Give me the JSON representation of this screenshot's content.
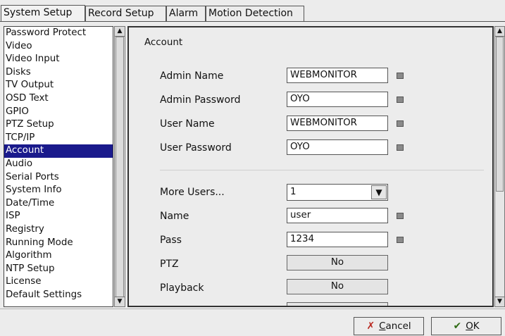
{
  "tabs": [
    "System Setup",
    "Record Setup",
    "Alarm",
    "Motion Detection"
  ],
  "sidebar": {
    "items": [
      "Password Protect",
      "Video",
      "Video Input",
      "Disks",
      "TV Output",
      "OSD Text",
      "GPIO",
      "PTZ Setup",
      "TCP/IP",
      "Account",
      "Audio",
      "Serial Ports",
      "System Info",
      "Date/Time",
      "ISP",
      "Registry",
      "Running Mode",
      "Algorithm",
      "NTP Setup",
      "License",
      "Default Settings"
    ],
    "selected": "Account"
  },
  "account": {
    "section_title": "Account",
    "admin_name_label": "Admin Name",
    "admin_name_value": "WEBMONITOR",
    "admin_password_label": "Admin Password",
    "admin_password_value": "OYO",
    "user_name_label": "User Name",
    "user_name_value": "WEBMONITOR",
    "user_password_label": "User Password",
    "user_password_value": "OYO",
    "more_users_label": "More Users...",
    "more_users_value": "1",
    "name_label": "Name",
    "name_value": "user",
    "pass_label": "Pass",
    "pass_value": "1234",
    "ptz_label": "PTZ",
    "ptz_value": "No",
    "playback_label": "Playback",
    "playback_value": "No"
  },
  "buttons": {
    "cancel_mnemonic": "C",
    "cancel_rest": "ancel",
    "ok_mnemonic": "O",
    "ok_rest": "K"
  },
  "colors": {
    "selection": "#1a1a8c"
  },
  "icons": [
    "keyboard-icon",
    "cancel-x-icon",
    "ok-check-icon",
    "arrow-up-icon",
    "arrow-down-icon",
    "chevron-down-icon"
  ]
}
